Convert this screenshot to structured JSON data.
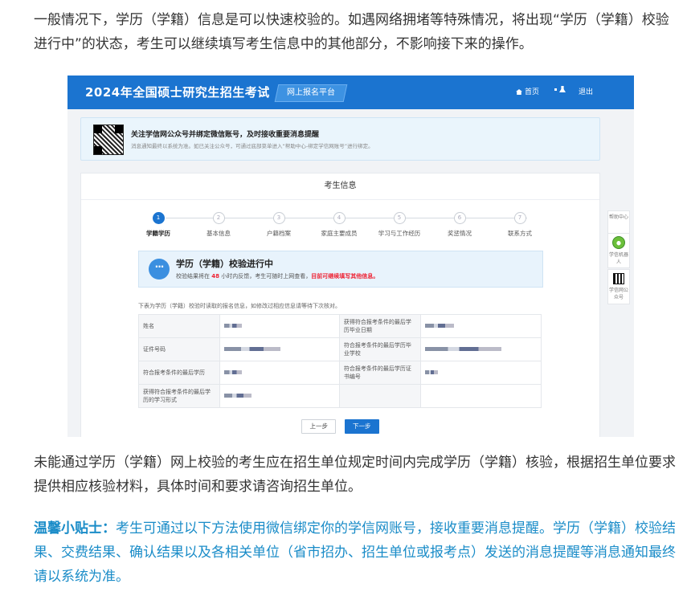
{
  "article": {
    "p1": "一般情况下，学历（学籍）信息是可以快速校验的。如遇网络拥堵等特殊情况，将出现“学历（学籍）校验进行中”的状态，考生可以继续填写考生信息中的其他部分，不影响接下来的操作。",
    "p2": "未能通过学历（学籍）网上校验的考生应在招生单位规定时间内完成学历（学籍）核验，根据招生单位要求提供相应核验材料，具体时间和要求请咨询招生单位。",
    "tip_label": "温馨小贴士：",
    "tip_text": "考生可通过以下方法使用微信绑定你的学信网账号，接收重要消息提醒。学历（学籍）校验结果、交费结果、确认结果以及各相关单位（省市招办、招生单位或报考点）发送的消息提醒等消息通知最终请以系统为准。"
  },
  "screenshot": {
    "header": {
      "title": "2024年全国硕士研究生招生考试",
      "tag": "网上报名平台",
      "home": "首页",
      "logout": "退出"
    },
    "notice": {
      "title": "关注学信网公众号并绑定微信账号，及时接收重要消息提醒",
      "subtitle": "消息通知最终以系统为准。如已关注公众号，可通过底部菜单进入“帮助中心-绑定学信网账号”进行绑定。"
    },
    "panel_title": "考生信息",
    "steps": [
      {
        "num": "1",
        "label": "学籍学历"
      },
      {
        "num": "2",
        "label": "基本信息"
      },
      {
        "num": "3",
        "label": "户籍档案"
      },
      {
        "num": "4",
        "label": "家庭主要成员"
      },
      {
        "num": "5",
        "label": "学习与工作经历"
      },
      {
        "num": "6",
        "label": "奖惩情况"
      },
      {
        "num": "7",
        "label": "联系方式"
      }
    ],
    "status": {
      "title": "学历（学籍）校验进行中",
      "msg_pre": "校验结果将在",
      "msg_num": "48",
      "msg_mid": "小时内反馈，考生可随时上网查看，",
      "msg_red": "目前可继续填写其他信息。"
    },
    "table_note": "下表为学历（学籍）校验时读取的报名信息，如修改过相应信息请等待下次核对。",
    "table": [
      [
        "姓名",
        "获得符合报考条件的最后学历毕业日期"
      ],
      [
        "证件号码",
        "符合报考条件的最后学历毕业学校"
      ],
      [
        "符合报考条件的最后学历",
        "符合报考条件的最后学历证书编号"
      ],
      [
        "获得符合报考条件的最后学历的学习形式",
        ""
      ]
    ],
    "buttons": {
      "prev": "上一步",
      "next": "下一步"
    },
    "float": {
      "help": "帮助中心",
      "robot": "学信机器人",
      "qr": "学信网公众号"
    }
  }
}
